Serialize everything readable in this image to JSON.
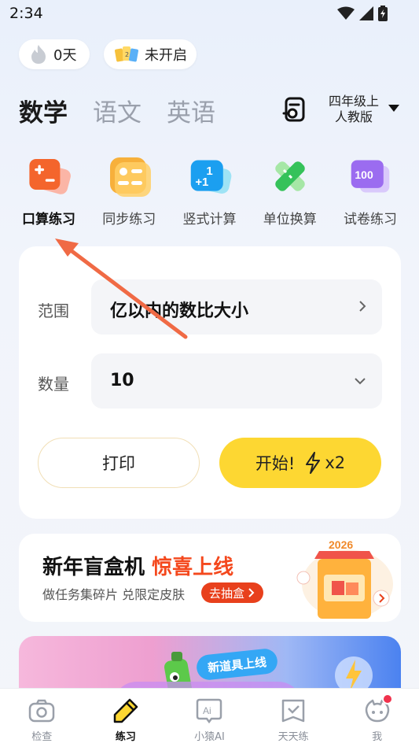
{
  "status_bar": {
    "time": "2:34"
  },
  "pills": {
    "streak": "0天",
    "status": "未开启"
  },
  "subjects": [
    {
      "label": "数学",
      "active": true
    },
    {
      "label": "语文",
      "active": false
    },
    {
      "label": "英语",
      "active": false
    }
  ],
  "grade": {
    "line1": "四年级上",
    "line2": "人教版"
  },
  "features": [
    {
      "label": "口算练习",
      "icon": "calculator-icon",
      "active": true
    },
    {
      "label": "同步练习",
      "icon": "sync-practice-icon",
      "active": false
    },
    {
      "label": "竖式计算",
      "icon": "vertical-calc-icon",
      "active": false
    },
    {
      "label": "单位换算",
      "icon": "ruler-icon",
      "active": false
    },
    {
      "label": "试卷练习",
      "icon": "exam-paper-icon",
      "active": false
    }
  ],
  "practice": {
    "range_label": "范围",
    "range_value": "亿以内的数比大小",
    "count_label": "数量",
    "count_value": "10",
    "print_label": "打印",
    "start_label": "开始!",
    "multiplier": "x2"
  },
  "banner1": {
    "title": "新年盲盒机",
    "highlight": "惊喜上线",
    "subtitle": "做任务集碎片 兑限定皮肤",
    "cta": "去抽盒",
    "year": "2026"
  },
  "banner2": {
    "tag": "新道具上线"
  },
  "nav": [
    {
      "label": "检查",
      "icon": "camera-icon",
      "active": false
    },
    {
      "label": "练习",
      "icon": "pencil-icon",
      "active": true
    },
    {
      "label": "小猿AI",
      "icon": "ai-chat-icon",
      "active": false
    },
    {
      "label": "天天练",
      "icon": "daily-check-icon",
      "active": false
    },
    {
      "label": "我",
      "icon": "profile-icon",
      "active": false
    }
  ],
  "colors": {
    "accent_yellow": "#fdd732",
    "highlight_red": "#f4481d",
    "annotation": "#f06a45"
  }
}
